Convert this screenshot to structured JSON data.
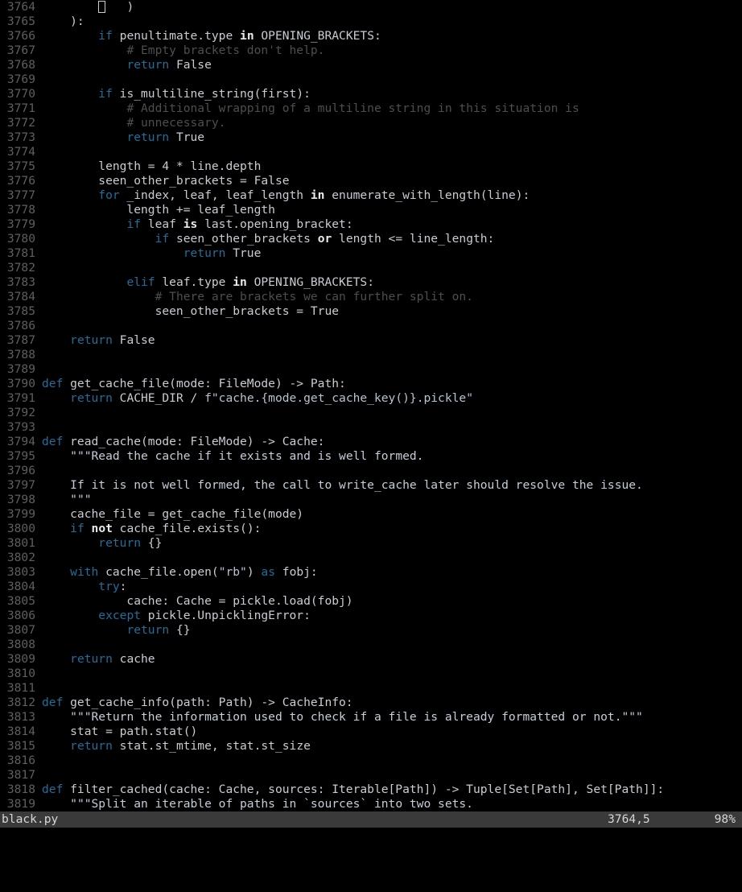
{
  "app": {
    "name": "vim",
    "file": "black.py"
  },
  "status": {
    "file": "black.py",
    "position": "3764,5",
    "percent": "98%",
    "command": ""
  },
  "cursor": {
    "line": 3764,
    "column": 5,
    "style": "hollow-block"
  },
  "colors": {
    "background": "#000000",
    "foreground": "#c8cdd2",
    "line_number": "#5f5f5f",
    "keyword": "#1f6f9a",
    "keyword_bold": "#e8eaec",
    "comment": "#4e4e4e",
    "string": "#b5c4d0",
    "status_bar_bg": "#3a3a3a",
    "status_bar_fg": "#d6d6d6"
  },
  "editor": {
    "first_line_number": 3764,
    "lines": [
      {
        "n": "3764",
        "tokens": [
          {
            "t": "plain",
            "v": "        "
          },
          {
            "t": "cursor",
            "v": " "
          },
          {
            "t": "plain",
            "v": "   )"
          }
        ]
      },
      {
        "n": "3765",
        "tokens": [
          {
            "t": "plain",
            "v": "    ):"
          }
        ]
      },
      {
        "n": "3766",
        "tokens": [
          {
            "t": "plain",
            "v": "        "
          },
          {
            "t": "kw",
            "v": "if"
          },
          {
            "t": "plain",
            "v": " penultimate.type "
          },
          {
            "t": "kwb",
            "v": "in"
          },
          {
            "t": "plain",
            "v": " OPENING_BRACKETS:"
          }
        ]
      },
      {
        "n": "3767",
        "tokens": [
          {
            "t": "plain",
            "v": "            "
          },
          {
            "t": "comment",
            "v": "# Empty brackets don't help."
          }
        ]
      },
      {
        "n": "3768",
        "tokens": [
          {
            "t": "plain",
            "v": "            "
          },
          {
            "t": "kw",
            "v": "return"
          },
          {
            "t": "plain",
            "v": " False"
          }
        ]
      },
      {
        "n": "3769",
        "tokens": []
      },
      {
        "n": "3770",
        "tokens": [
          {
            "t": "plain",
            "v": "        "
          },
          {
            "t": "kw",
            "v": "if"
          },
          {
            "t": "plain",
            "v": " is_multiline_string(first):"
          }
        ]
      },
      {
        "n": "3771",
        "tokens": [
          {
            "t": "plain",
            "v": "            "
          },
          {
            "t": "comment",
            "v": "# Additional wrapping of a multiline string in this situation is"
          }
        ]
      },
      {
        "n": "3772",
        "tokens": [
          {
            "t": "plain",
            "v": "            "
          },
          {
            "t": "comment",
            "v": "# unnecessary."
          }
        ]
      },
      {
        "n": "3773",
        "tokens": [
          {
            "t": "plain",
            "v": "            "
          },
          {
            "t": "kw",
            "v": "return"
          },
          {
            "t": "plain",
            "v": " True"
          }
        ]
      },
      {
        "n": "3774",
        "tokens": []
      },
      {
        "n": "3775",
        "tokens": [
          {
            "t": "plain",
            "v": "        length = 4 * line.depth"
          }
        ]
      },
      {
        "n": "3776",
        "tokens": [
          {
            "t": "plain",
            "v": "        seen_other_brackets = False"
          }
        ]
      },
      {
        "n": "3777",
        "tokens": [
          {
            "t": "plain",
            "v": "        "
          },
          {
            "t": "kw",
            "v": "for"
          },
          {
            "t": "plain",
            "v": " _index, leaf, leaf_length "
          },
          {
            "t": "kwb",
            "v": "in"
          },
          {
            "t": "plain",
            "v": " enumerate_with_length(line):"
          }
        ]
      },
      {
        "n": "3778",
        "tokens": [
          {
            "t": "plain",
            "v": "            length += leaf_length"
          }
        ]
      },
      {
        "n": "3779",
        "tokens": [
          {
            "t": "plain",
            "v": "            "
          },
          {
            "t": "kw",
            "v": "if"
          },
          {
            "t": "plain",
            "v": " leaf "
          },
          {
            "t": "kwb",
            "v": "is"
          },
          {
            "t": "plain",
            "v": " last.opening_bracket:"
          }
        ]
      },
      {
        "n": "3780",
        "tokens": [
          {
            "t": "plain",
            "v": "                "
          },
          {
            "t": "kw",
            "v": "if"
          },
          {
            "t": "plain",
            "v": " seen_other_brackets "
          },
          {
            "t": "kwb",
            "v": "or"
          },
          {
            "t": "plain",
            "v": " length <= line_length:"
          }
        ]
      },
      {
        "n": "3781",
        "tokens": [
          {
            "t": "plain",
            "v": "                    "
          },
          {
            "t": "kw",
            "v": "return"
          },
          {
            "t": "plain",
            "v": " True"
          }
        ]
      },
      {
        "n": "3782",
        "tokens": []
      },
      {
        "n": "3783",
        "tokens": [
          {
            "t": "plain",
            "v": "            "
          },
          {
            "t": "kw",
            "v": "elif"
          },
          {
            "t": "plain",
            "v": " leaf.type "
          },
          {
            "t": "kwb",
            "v": "in"
          },
          {
            "t": "plain",
            "v": " OPENING_BRACKETS:"
          }
        ]
      },
      {
        "n": "3784",
        "tokens": [
          {
            "t": "plain",
            "v": "                "
          },
          {
            "t": "comment",
            "v": "# There are brackets we can further split on."
          }
        ]
      },
      {
        "n": "3785",
        "tokens": [
          {
            "t": "plain",
            "v": "                seen_other_brackets = True"
          }
        ]
      },
      {
        "n": "3786",
        "tokens": []
      },
      {
        "n": "3787",
        "tokens": [
          {
            "t": "plain",
            "v": "    "
          },
          {
            "t": "kw",
            "v": "return"
          },
          {
            "t": "plain",
            "v": " False"
          }
        ]
      },
      {
        "n": "3788",
        "tokens": []
      },
      {
        "n": "3789",
        "tokens": []
      },
      {
        "n": "3790",
        "tokens": [
          {
            "t": "kw",
            "v": "def"
          },
          {
            "t": "plain",
            "v": " get_cache_file(mode: FileMode) -> Path:"
          }
        ]
      },
      {
        "n": "3791",
        "tokens": [
          {
            "t": "plain",
            "v": "    "
          },
          {
            "t": "kw",
            "v": "return"
          },
          {
            "t": "plain",
            "v": " CACHE_DIR / "
          },
          {
            "t": "str",
            "v": "f\"cache.{mode.get_cache_key()}.pickle\""
          }
        ]
      },
      {
        "n": "3792",
        "tokens": []
      },
      {
        "n": "3793",
        "tokens": []
      },
      {
        "n": "3794",
        "tokens": [
          {
            "t": "kw",
            "v": "def"
          },
          {
            "t": "plain",
            "v": " read_cache(mode: FileMode) -> Cache:"
          }
        ]
      },
      {
        "n": "3795",
        "tokens": [
          {
            "t": "plain",
            "v": "    "
          },
          {
            "t": "doc",
            "v": "\"\"\"Read the cache if it exists and is well formed."
          }
        ]
      },
      {
        "n": "3796",
        "tokens": []
      },
      {
        "n": "3797",
        "tokens": [
          {
            "t": "plain",
            "v": "    "
          },
          {
            "t": "doc",
            "v": "If it is not well formed, the call to write_cache later should resolve the issue."
          }
        ]
      },
      {
        "n": "3798",
        "tokens": [
          {
            "t": "plain",
            "v": "    "
          },
          {
            "t": "doc",
            "v": "\"\"\""
          }
        ]
      },
      {
        "n": "3799",
        "tokens": [
          {
            "t": "plain",
            "v": "    cache_file = get_cache_file(mode)"
          }
        ]
      },
      {
        "n": "3800",
        "tokens": [
          {
            "t": "plain",
            "v": "    "
          },
          {
            "t": "kw",
            "v": "if"
          },
          {
            "t": "plain",
            "v": " "
          },
          {
            "t": "kwb",
            "v": "not"
          },
          {
            "t": "plain",
            "v": " cache_file.exists():"
          }
        ]
      },
      {
        "n": "3801",
        "tokens": [
          {
            "t": "plain",
            "v": "        "
          },
          {
            "t": "kw",
            "v": "return"
          },
          {
            "t": "plain",
            "v": " {}"
          }
        ]
      },
      {
        "n": "3802",
        "tokens": []
      },
      {
        "n": "3803",
        "tokens": [
          {
            "t": "plain",
            "v": "    "
          },
          {
            "t": "kw",
            "v": "with"
          },
          {
            "t": "plain",
            "v": " cache_file.open("
          },
          {
            "t": "str",
            "v": "\"rb\""
          },
          {
            "t": "plain",
            "v": ") "
          },
          {
            "t": "kw",
            "v": "as"
          },
          {
            "t": "plain",
            "v": " fobj:"
          }
        ]
      },
      {
        "n": "3804",
        "tokens": [
          {
            "t": "plain",
            "v": "        "
          },
          {
            "t": "kw",
            "v": "try"
          },
          {
            "t": "plain",
            "v": ":"
          }
        ]
      },
      {
        "n": "3805",
        "tokens": [
          {
            "t": "plain",
            "v": "            cache: Cache = pickle.load(fobj)"
          }
        ]
      },
      {
        "n": "3806",
        "tokens": [
          {
            "t": "plain",
            "v": "        "
          },
          {
            "t": "kw",
            "v": "except"
          },
          {
            "t": "plain",
            "v": " pickle.UnpicklingError:"
          }
        ]
      },
      {
        "n": "3807",
        "tokens": [
          {
            "t": "plain",
            "v": "            "
          },
          {
            "t": "kw",
            "v": "return"
          },
          {
            "t": "plain",
            "v": " {}"
          }
        ]
      },
      {
        "n": "3808",
        "tokens": []
      },
      {
        "n": "3809",
        "tokens": [
          {
            "t": "plain",
            "v": "    "
          },
          {
            "t": "kw",
            "v": "return"
          },
          {
            "t": "plain",
            "v": " cache"
          }
        ]
      },
      {
        "n": "3810",
        "tokens": []
      },
      {
        "n": "3811",
        "tokens": []
      },
      {
        "n": "3812",
        "tokens": [
          {
            "t": "kw",
            "v": "def"
          },
          {
            "t": "plain",
            "v": " get_cache_info(path: Path) -> CacheInfo:"
          }
        ]
      },
      {
        "n": "3813",
        "tokens": [
          {
            "t": "plain",
            "v": "    "
          },
          {
            "t": "doc",
            "v": "\"\"\"Return the information used to check if a file is already formatted or not.\"\"\""
          }
        ]
      },
      {
        "n": "3814",
        "tokens": [
          {
            "t": "plain",
            "v": "    stat = path.stat()"
          }
        ]
      },
      {
        "n": "3815",
        "tokens": [
          {
            "t": "plain",
            "v": "    "
          },
          {
            "t": "kw",
            "v": "return"
          },
          {
            "t": "plain",
            "v": " stat.st_mtime, stat.st_size"
          }
        ]
      },
      {
        "n": "3816",
        "tokens": []
      },
      {
        "n": "3817",
        "tokens": []
      },
      {
        "n": "3818",
        "tokens": [
          {
            "t": "kw",
            "v": "def"
          },
          {
            "t": "plain",
            "v": " filter_cached(cache: Cache, sources: Iterable[Path]) -> Tuple[Set[Path], Set[Path]]:"
          }
        ]
      },
      {
        "n": "3819",
        "tokens": [
          {
            "t": "plain",
            "v": "    "
          },
          {
            "t": "doc",
            "v": "\"\"\"Split an iterable of paths in `sources` into two sets."
          }
        ]
      }
    ]
  }
}
